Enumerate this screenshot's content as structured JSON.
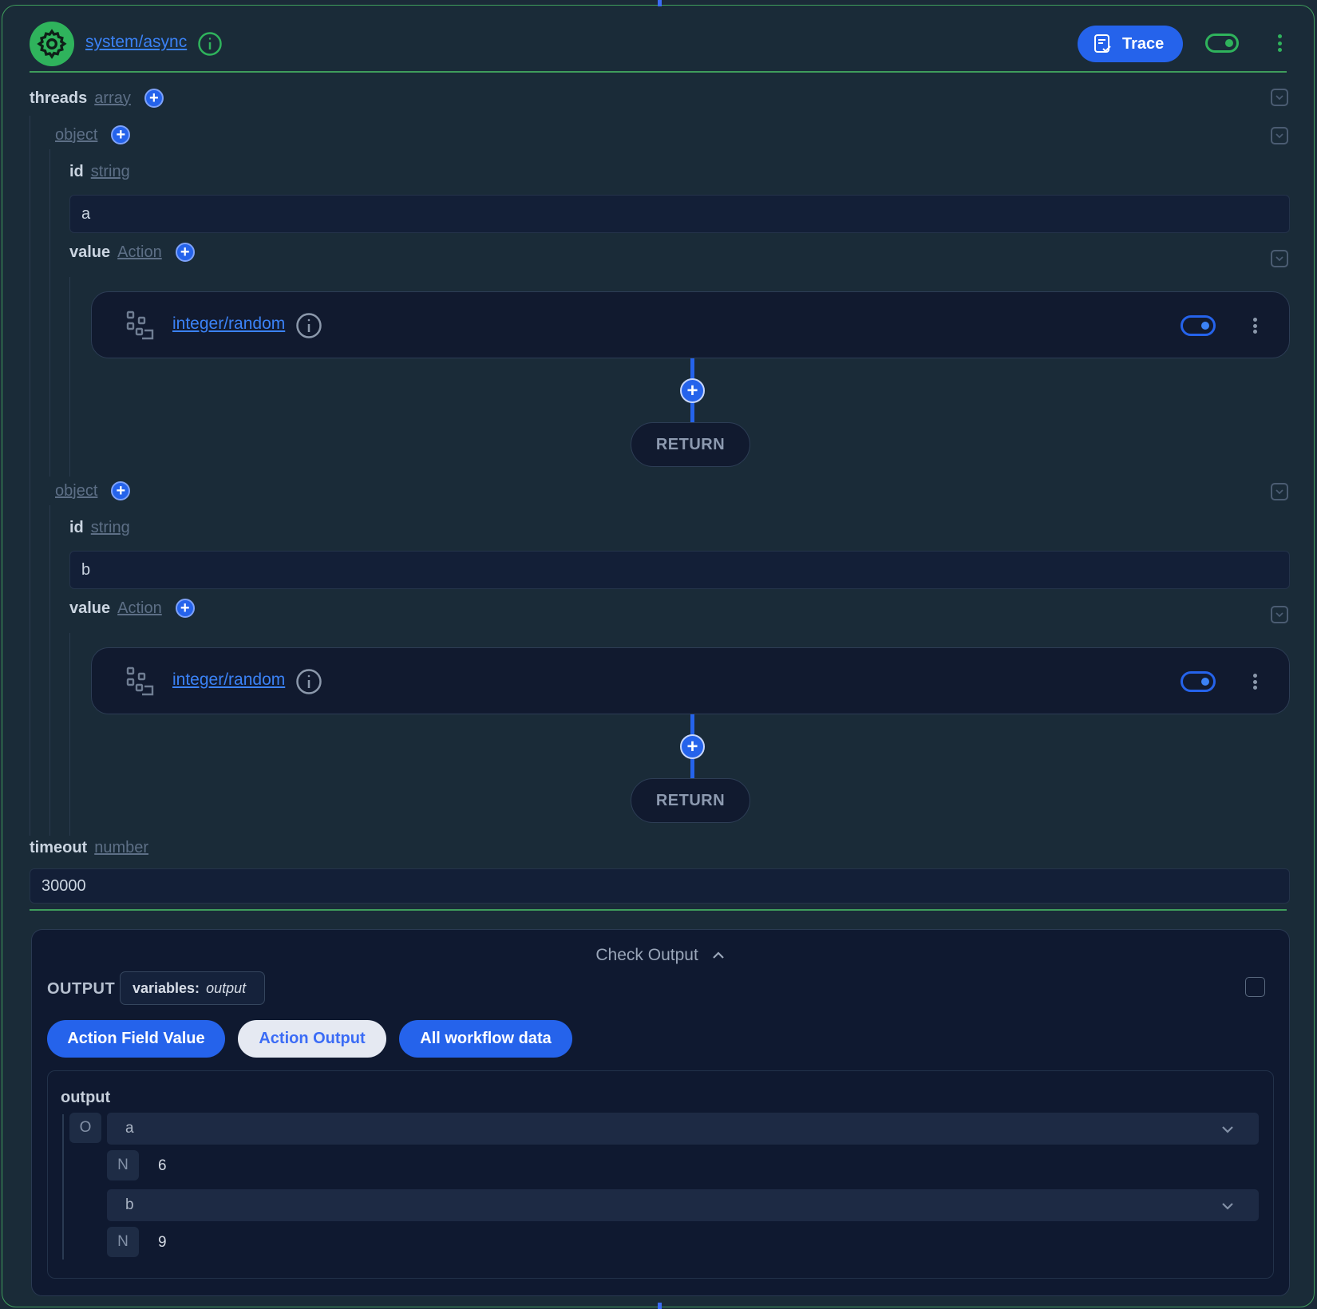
{
  "header": {
    "app_name": "system/async",
    "trace_label": "Trace"
  },
  "threads": {
    "name": "threads",
    "type": "array",
    "items": [
      {
        "type": "object",
        "id_label": "id",
        "id_type": "string",
        "id_value": "a",
        "value_label": "value",
        "value_type": "Action",
        "action_name": "integer/random",
        "return_label": "RETURN"
      },
      {
        "type": "object",
        "id_label": "id",
        "id_type": "string",
        "id_value": "b",
        "value_label": "value",
        "value_type": "Action",
        "action_name": "integer/random",
        "return_label": "RETURN"
      }
    ]
  },
  "timeout": {
    "name": "timeout",
    "type": "number",
    "value": "30000"
  },
  "check_output": {
    "title": "Check Output",
    "output_label": "OUTPUT",
    "variables_key": "variables:",
    "variables_value": "output",
    "tabs": [
      "Action Field Value",
      "Action Output",
      "All workflow data"
    ],
    "active_tab": "Action Output",
    "result": {
      "name": "output",
      "root_type": "O",
      "entries": [
        {
          "key": "a",
          "type": "N",
          "value": "6"
        },
        {
          "key": "b",
          "type": "N",
          "value": "9"
        }
      ]
    }
  },
  "colors": {
    "accent_green": "#2fb35c",
    "accent_blue": "#2563eb",
    "background": "#1a2b38"
  }
}
